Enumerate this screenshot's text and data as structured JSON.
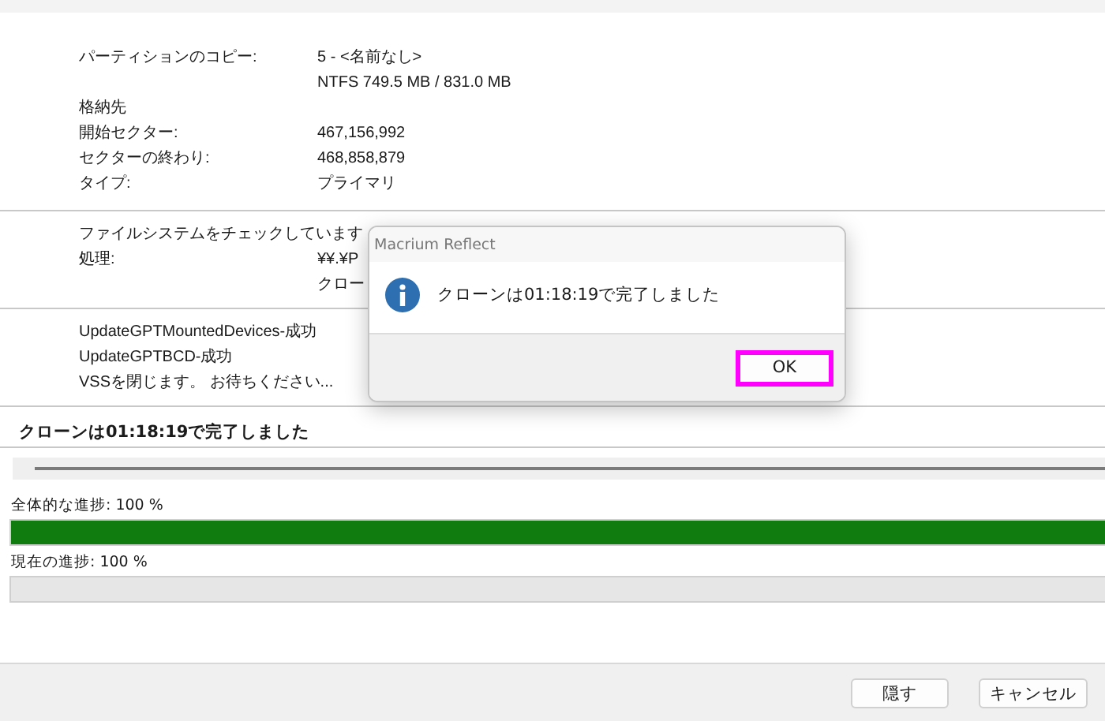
{
  "sections": [
    {
      "rows": [
        {
          "label": "パーティションのコピー:",
          "values": [
            "5 - <名前なし>",
            "NTFS 749.5 MB / 831.0 MB"
          ]
        },
        {
          "label": "格納先"
        },
        {
          "label": "開始セクター:",
          "values": [
            "467,156,992"
          ]
        },
        {
          "label": "セクターの終わり:",
          "values": [
            "468,858,879"
          ]
        },
        {
          "label": "タイプ:",
          "values": [
            "プライマリ"
          ]
        }
      ]
    },
    {
      "rows": [
        {
          "label": "ファイルシステムをチェックしています"
        },
        {
          "label": "処理:",
          "values": [
            "¥¥.¥P",
            "クロー"
          ]
        }
      ]
    },
    {
      "rows": [
        {
          "label": "UpdateGPTMountedDevices-成功"
        },
        {
          "label": "UpdateGPTBCD-成功"
        },
        {
          "label": "VSSを閉じます。 お待ちください..."
        }
      ]
    }
  ],
  "status": "クローンは01:18:19で完了しました",
  "progress": [
    {
      "label": "全体的な進捗: 100 %",
      "level": 1
    },
    {
      "label": "現在の進捗: 100 %",
      "level": 0
    }
  ],
  "buttons": [
    "隠す",
    "キャンセル"
  ],
  "dialog": {
    "title": "Macrium Reflect",
    "message": "クローンは01:18:19で完了しました",
    "buttons": [
      {
        "label": "OK",
        "focused": true
      }
    ]
  }
}
